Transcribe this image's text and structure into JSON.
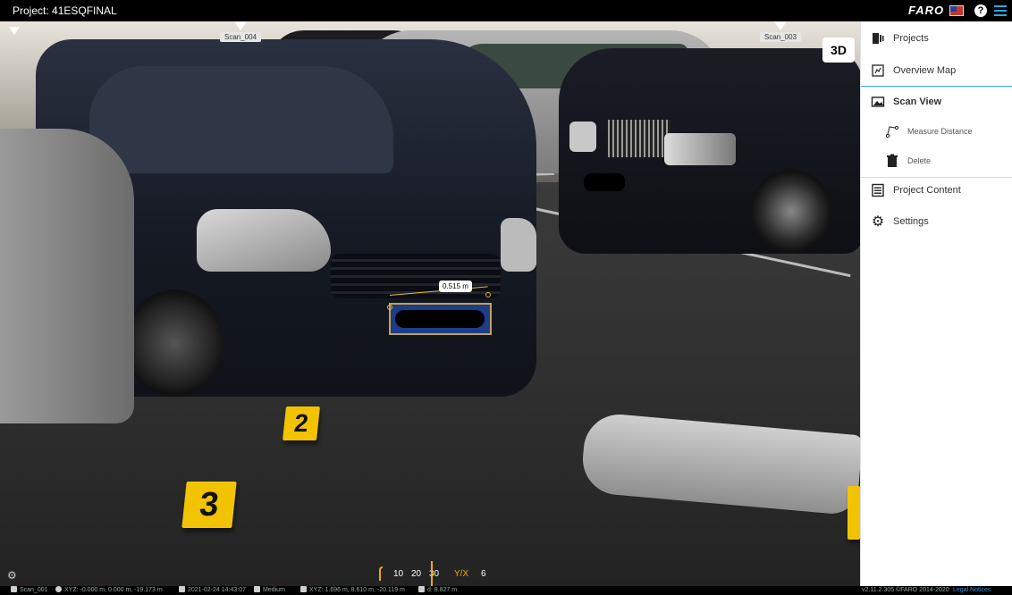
{
  "topbar": {
    "project_title": "Project: 41ESQFINAL",
    "brand": "FARO"
  },
  "viewport": {
    "scan_pins": [
      "Scan_004",
      "Scan_003"
    ],
    "view_mode_button": "3D",
    "measurement_label": "0.515 m",
    "evidence_markers": [
      "2",
      "3"
    ],
    "compass": {
      "ticks": [
        "10",
        "20",
        "30",
        "Y/X",
        "6"
      ]
    }
  },
  "sidepanel": {
    "items": [
      {
        "label": "Projects",
        "icon": "projects-icon"
      },
      {
        "label": "Overview Map",
        "icon": "map-icon"
      },
      {
        "label": "Scan View",
        "icon": "image-icon"
      },
      {
        "label": "Measure Distance",
        "icon": "measure-icon"
      },
      {
        "label": "Delete",
        "icon": "trash-icon"
      },
      {
        "label": "Project Content",
        "icon": "list-icon"
      },
      {
        "label": "Settings",
        "icon": "gear-icon"
      }
    ]
  },
  "statusbar": {
    "scan_name": "Scan_001",
    "xyz_position": "XYZ: -0.000 m, 0.000 m, -19.173 m",
    "date_time": "2021-02-24 14:43:07",
    "quality": "Medium",
    "xyz_pointer": "XYZ: 1.696 m, 8.610 m, -20.119 m",
    "distance": "d: 8.827 m",
    "version": "v2.11.2.305 ©FARO 2014-2020",
    "legal": "Legal Notices"
  },
  "colors": {
    "accent": "#2ca7e0",
    "measure": "#e4b93a",
    "marker": "#f2c300"
  }
}
